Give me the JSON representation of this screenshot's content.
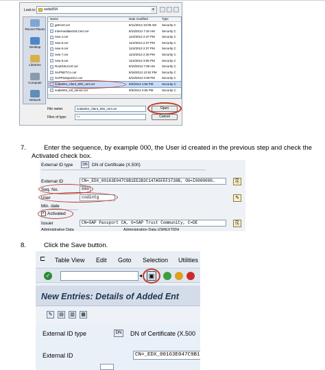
{
  "dialog": {
    "look_in_label": "Look in:",
    "look_in_value": "sodw004",
    "places": [
      "Recent Places",
      "Desktop",
      "Libraries",
      "Computer",
      "Network"
    ],
    "columns": [
      "Name",
      "Date modified",
      "Type"
    ],
    "files": [
      {
        "name": "getCert.cer",
        "date": "8/11/2013 10:09 AM",
        "type": "Security C"
      },
      {
        "name": "IntermediateSSLCert.cer",
        "date": "8/10/2013 7:40 AM",
        "type": "Security C"
      },
      {
        "name": "new 4.cer",
        "date": "11/4/2013 2:37 PM",
        "type": "Security C"
      },
      {
        "name": "new 5.cer",
        "date": "11/4/2013 2:37 PM",
        "type": "Security C"
      },
      {
        "name": "new 6.cer",
        "date": "11/4/2013 2:37 PM",
        "type": "Security C"
      },
      {
        "name": "new 7.cer",
        "date": "11/4/2013 2:40 PM",
        "type": "Security C"
      },
      {
        "name": "new 8.cer",
        "date": "11/4/2013 3:05 PM",
        "type": "Security C"
      },
      {
        "name": "RootSSLCert.cer",
        "date": "8/10/2013 7:39 AM",
        "type": "Security C"
      },
      {
        "name": "SAPNETCA.cer",
        "date": "8/16/2013 12:52 PM",
        "type": "Security C"
      },
      {
        "name": "SAPPassportCA.cer",
        "date": "8/10/2013 3:38 PM",
        "type": "Security C"
      },
      {
        "name": "sodw004_client_500_cert.cer",
        "date": "9/3/2013 1:59 PM",
        "type": "Security C"
      },
      {
        "name": "sodw004_ssl_server.cer",
        "date": "9/3/2013 2:55 PM",
        "type": "Security C"
      }
    ],
    "selected_index": 10,
    "file_name_label": "File name:",
    "file_name_value": "sodw004_client_500_cert.cer",
    "file_type_label": "Files of type:",
    "file_type_value": "*.*",
    "open_label": "Open",
    "cancel_label": "Cancel"
  },
  "step7": {
    "number": "7.",
    "line1": "Enter the sequence, by example 000, the User id created in the previous step and check the",
    "line2": "Activated  check box."
  },
  "form1": {
    "external_id_type_label": "External ID type",
    "dn_badge": "DN",
    "dn_text": "DN of Certificate (X.500)",
    "external_id_label": "External ID",
    "external_id_value": "CN=_EDX_00163E047C9B1EE2B3C147A5FEF3738B, OU=I0000000…",
    "seq_no_label": "Seq. No.",
    "seq_no_value": "000",
    "user_label": "User",
    "user_value": "codintg",
    "min_date_label": "Min. date",
    "activated_label": "Activated",
    "issuer_label": "Issuer",
    "issuer_value": "CN=SAP Passport CA, O=SAP Trust Community, C=DE",
    "admin_data_label": "Administrative Data",
    "admin_data_label2": "Administration Data USREXTIDH"
  },
  "step8": {
    "number": "8.",
    "text": "Click the Save button."
  },
  "sap": {
    "menu": [
      "Table View",
      "Edit",
      "Goto",
      "Selection",
      "Utilities"
    ],
    "title": "New Entries: Details of Added Ent",
    "external_id_type_label": "External ID type",
    "dn_badge": "DN",
    "dn_text": "DN of Certificate (X.500",
    "external_id_label": "External ID",
    "external_id_value": "CN=_EDX_00163E047C9B1EE2B3C"
  },
  "colors": {
    "highlight": "#c0392b",
    "sap_bg": "#eaf0f7",
    "title_text": "#1f3550"
  }
}
